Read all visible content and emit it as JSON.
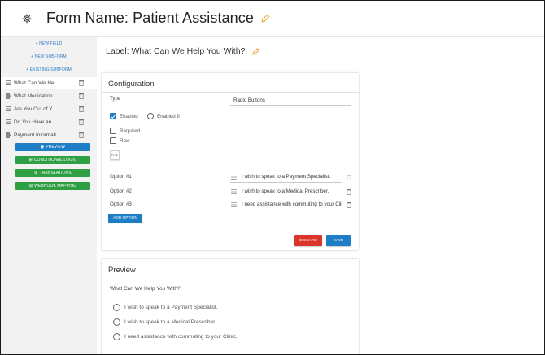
{
  "header": {
    "title": "Form Name: Patient Assistance"
  },
  "sidebar": {
    "new_field": "+ NEW FIELD",
    "new_subform": "+ NEW SUBFORM",
    "existing_subform": "+ EXISTING SUBFORM",
    "fields": [
      {
        "label": "What Can We Hel...",
        "icon": "list-icon"
      },
      {
        "label": "What Medication ...",
        "icon": "subform-icon"
      },
      {
        "label": "Are You Out of Y...",
        "icon": "list-icon"
      },
      {
        "label": "Do You Have an ...",
        "icon": "list-icon"
      },
      {
        "label": "Payment Informati...",
        "icon": "subform-icon"
      }
    ],
    "preview": "PREVIEW",
    "conditional_logic": "CONDITIONAL LOGIC",
    "translations": "TRANSLATIONS",
    "webhook_mapping": "WEBHOOK MAPPING"
  },
  "main": {
    "label": "Label: What Can We Help You With?"
  },
  "config": {
    "title": "Configuration",
    "type_label": "Type",
    "type_value": "Radio Buttons",
    "enabled": "Enabled",
    "enabled_if": "Enabled If",
    "required": "Required",
    "row": "Row",
    "sort_glyph": "A↓Z",
    "options": [
      {
        "label": "Option #1",
        "value": "I wish to speak to a Payment Specialist."
      },
      {
        "label": "Option #2",
        "value": "I wish to speak to a Medical Prescriber."
      },
      {
        "label": "Option #3",
        "value": "I need assistance with commuting to your Clinic."
      }
    ],
    "add_option": "ADD OPTION",
    "discard": "DISCARD",
    "save": "SAVE"
  },
  "preview": {
    "title": "Preview",
    "question": "What Can We Help You With?",
    "choices": [
      "I wish to speak to a Payment Specialist.",
      "I wish to speak to a Medical Prescriber.",
      "I need assistance with commuting to your Clinic."
    ]
  },
  "colors": {
    "accent": "#1d7ec6",
    "success": "#2ea043",
    "danger": "#d9352b",
    "pencil": "#e8a33a"
  }
}
